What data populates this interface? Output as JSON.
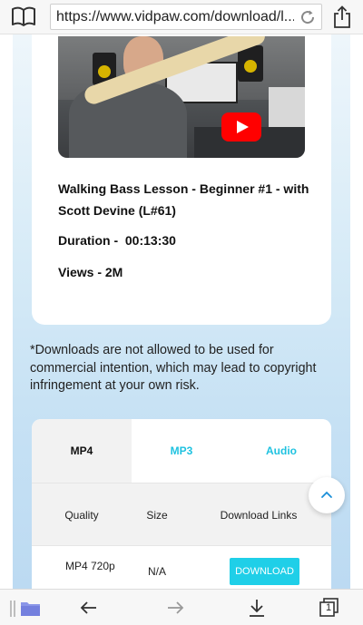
{
  "browser": {
    "url": "https://www.vidpaw.com/download/l...",
    "tabs_count": "1"
  },
  "video": {
    "title": "Walking Bass Lesson - Beginner #1 - with Scott Devine (L#61)",
    "duration": "Duration -  00:13:30",
    "views": "Views - 2M"
  },
  "disclaimer": "*Downloads are not allowed to be used for commercial intention, which may lead to copyright infringement at your own risk.",
  "download_table": {
    "tabs": [
      {
        "label": "MP4",
        "active": true
      },
      {
        "label": "MP3",
        "active": false
      },
      {
        "label": "Audio",
        "active": false
      }
    ],
    "headers": {
      "quality": "Quality",
      "size": "Size",
      "links": "Download Links"
    },
    "rows": [
      {
        "quality": "MP4 720p",
        "size": "N/A",
        "button": "DOWNLOAD"
      }
    ]
  },
  "colors": {
    "accent": "#1fcfe8",
    "tab_text": "#1fc2e0",
    "youtube_red": "#ff0000"
  },
  "icons": {
    "top_left": "book-icon",
    "reload": "reload-icon",
    "share": "share-icon",
    "scroll_top": "chevron-up-icon",
    "folder": "folder-icon",
    "back": "back-arrow-icon",
    "forward": "forward-arrow-icon",
    "download": "download-icon",
    "tabs": "tabs-icon"
  }
}
